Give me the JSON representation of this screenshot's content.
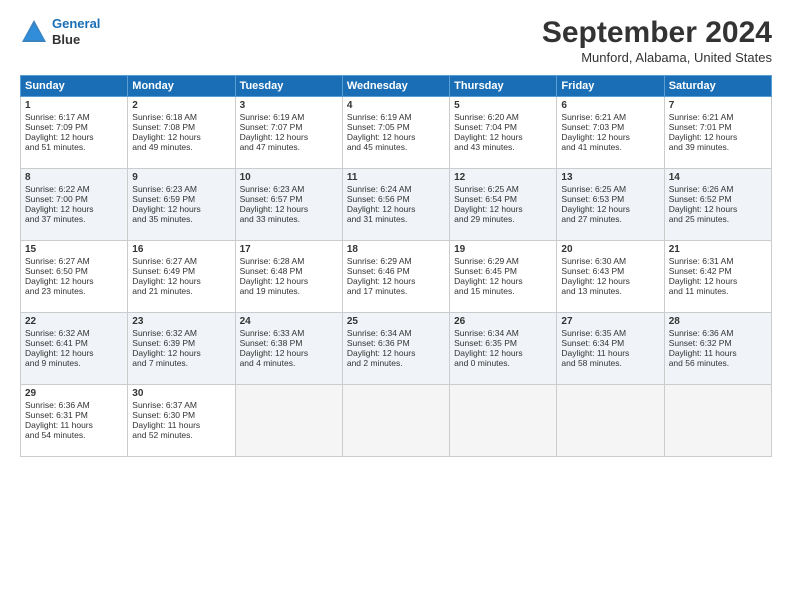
{
  "header": {
    "logo_line1": "General",
    "logo_line2": "Blue",
    "title": "September 2024",
    "subtitle": "Munford, Alabama, United States"
  },
  "days_of_week": [
    "Sunday",
    "Monday",
    "Tuesday",
    "Wednesday",
    "Thursday",
    "Friday",
    "Saturday"
  ],
  "weeks": [
    [
      {
        "day": 1,
        "lines": [
          "Sunrise: 6:17 AM",
          "Sunset: 7:09 PM",
          "Daylight: 12 hours",
          "and 51 minutes."
        ]
      },
      {
        "day": 2,
        "lines": [
          "Sunrise: 6:18 AM",
          "Sunset: 7:08 PM",
          "Daylight: 12 hours",
          "and 49 minutes."
        ]
      },
      {
        "day": 3,
        "lines": [
          "Sunrise: 6:19 AM",
          "Sunset: 7:07 PM",
          "Daylight: 12 hours",
          "and 47 minutes."
        ]
      },
      {
        "day": 4,
        "lines": [
          "Sunrise: 6:19 AM",
          "Sunset: 7:05 PM",
          "Daylight: 12 hours",
          "and 45 minutes."
        ]
      },
      {
        "day": 5,
        "lines": [
          "Sunrise: 6:20 AM",
          "Sunset: 7:04 PM",
          "Daylight: 12 hours",
          "and 43 minutes."
        ]
      },
      {
        "day": 6,
        "lines": [
          "Sunrise: 6:21 AM",
          "Sunset: 7:03 PM",
          "Daylight: 12 hours",
          "and 41 minutes."
        ]
      },
      {
        "day": 7,
        "lines": [
          "Sunrise: 6:21 AM",
          "Sunset: 7:01 PM",
          "Daylight: 12 hours",
          "and 39 minutes."
        ]
      }
    ],
    [
      {
        "day": 8,
        "lines": [
          "Sunrise: 6:22 AM",
          "Sunset: 7:00 PM",
          "Daylight: 12 hours",
          "and 37 minutes."
        ]
      },
      {
        "day": 9,
        "lines": [
          "Sunrise: 6:23 AM",
          "Sunset: 6:59 PM",
          "Daylight: 12 hours",
          "and 35 minutes."
        ]
      },
      {
        "day": 10,
        "lines": [
          "Sunrise: 6:23 AM",
          "Sunset: 6:57 PM",
          "Daylight: 12 hours",
          "and 33 minutes."
        ]
      },
      {
        "day": 11,
        "lines": [
          "Sunrise: 6:24 AM",
          "Sunset: 6:56 PM",
          "Daylight: 12 hours",
          "and 31 minutes."
        ]
      },
      {
        "day": 12,
        "lines": [
          "Sunrise: 6:25 AM",
          "Sunset: 6:54 PM",
          "Daylight: 12 hours",
          "and 29 minutes."
        ]
      },
      {
        "day": 13,
        "lines": [
          "Sunrise: 6:25 AM",
          "Sunset: 6:53 PM",
          "Daylight: 12 hours",
          "and 27 minutes."
        ]
      },
      {
        "day": 14,
        "lines": [
          "Sunrise: 6:26 AM",
          "Sunset: 6:52 PM",
          "Daylight: 12 hours",
          "and 25 minutes."
        ]
      }
    ],
    [
      {
        "day": 15,
        "lines": [
          "Sunrise: 6:27 AM",
          "Sunset: 6:50 PM",
          "Daylight: 12 hours",
          "and 23 minutes."
        ]
      },
      {
        "day": 16,
        "lines": [
          "Sunrise: 6:27 AM",
          "Sunset: 6:49 PM",
          "Daylight: 12 hours",
          "and 21 minutes."
        ]
      },
      {
        "day": 17,
        "lines": [
          "Sunrise: 6:28 AM",
          "Sunset: 6:48 PM",
          "Daylight: 12 hours",
          "and 19 minutes."
        ]
      },
      {
        "day": 18,
        "lines": [
          "Sunrise: 6:29 AM",
          "Sunset: 6:46 PM",
          "Daylight: 12 hours",
          "and 17 minutes."
        ]
      },
      {
        "day": 19,
        "lines": [
          "Sunrise: 6:29 AM",
          "Sunset: 6:45 PM",
          "Daylight: 12 hours",
          "and 15 minutes."
        ]
      },
      {
        "day": 20,
        "lines": [
          "Sunrise: 6:30 AM",
          "Sunset: 6:43 PM",
          "Daylight: 12 hours",
          "and 13 minutes."
        ]
      },
      {
        "day": 21,
        "lines": [
          "Sunrise: 6:31 AM",
          "Sunset: 6:42 PM",
          "Daylight: 12 hours",
          "and 11 minutes."
        ]
      }
    ],
    [
      {
        "day": 22,
        "lines": [
          "Sunrise: 6:32 AM",
          "Sunset: 6:41 PM",
          "Daylight: 12 hours",
          "and 9 minutes."
        ]
      },
      {
        "day": 23,
        "lines": [
          "Sunrise: 6:32 AM",
          "Sunset: 6:39 PM",
          "Daylight: 12 hours",
          "and 7 minutes."
        ]
      },
      {
        "day": 24,
        "lines": [
          "Sunrise: 6:33 AM",
          "Sunset: 6:38 PM",
          "Daylight: 12 hours",
          "and 4 minutes."
        ]
      },
      {
        "day": 25,
        "lines": [
          "Sunrise: 6:34 AM",
          "Sunset: 6:36 PM",
          "Daylight: 12 hours",
          "and 2 minutes."
        ]
      },
      {
        "day": 26,
        "lines": [
          "Sunrise: 6:34 AM",
          "Sunset: 6:35 PM",
          "Daylight: 12 hours",
          "and 0 minutes."
        ]
      },
      {
        "day": 27,
        "lines": [
          "Sunrise: 6:35 AM",
          "Sunset: 6:34 PM",
          "Daylight: 11 hours",
          "and 58 minutes."
        ]
      },
      {
        "day": 28,
        "lines": [
          "Sunrise: 6:36 AM",
          "Sunset: 6:32 PM",
          "Daylight: 11 hours",
          "and 56 minutes."
        ]
      }
    ],
    [
      {
        "day": 29,
        "lines": [
          "Sunrise: 6:36 AM",
          "Sunset: 6:31 PM",
          "Daylight: 11 hours",
          "and 54 minutes."
        ]
      },
      {
        "day": 30,
        "lines": [
          "Sunrise: 6:37 AM",
          "Sunset: 6:30 PM",
          "Daylight: 11 hours",
          "and 52 minutes."
        ]
      },
      null,
      null,
      null,
      null,
      null
    ]
  ]
}
